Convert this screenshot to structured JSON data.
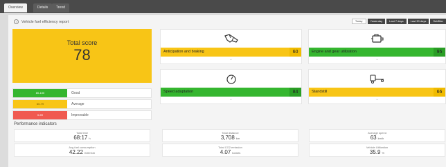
{
  "tabs": [
    {
      "label": "Overview"
    },
    {
      "label": "Details"
    },
    {
      "label": "Trend"
    }
  ],
  "report": {
    "title": "Vehicle fuel efficiency report"
  },
  "periods": [
    {
      "label": "Today"
    },
    {
      "label": "Yesterday"
    },
    {
      "label": "Last 7 days"
    },
    {
      "label": "Last 30 days"
    },
    {
      "label": "Set/filter"
    }
  ],
  "total_score": {
    "label": "Total score",
    "value": "78"
  },
  "legend": [
    {
      "range": "80-100",
      "label": "Good",
      "color": "#35b62f"
    },
    {
      "range": "60-79",
      "label": "Average",
      "color": "#f8c516"
    },
    {
      "range": "0-59",
      "label": "Improvable",
      "color": "#f05a50"
    }
  ],
  "categories": [
    {
      "label": "Anticipation and braking",
      "score": "60",
      "icon": "braking-hand-icon",
      "color": "yellow"
    },
    {
      "label": "Engine and gear utilization",
      "score": "95",
      "icon": "engine-icon",
      "color": "green"
    },
    {
      "label": "Speed adaptation",
      "score": "84",
      "icon": "speedometer-icon",
      "color": "green"
    },
    {
      "label": "Standstill",
      "score": "66",
      "icon": "standstill-truck-icon",
      "color": "yellow"
    }
  ],
  "performance": {
    "title": "Performance indicators",
    "stats": [
      {
        "label": "Total time",
        "value": "68:17",
        "unit": "h"
      },
      {
        "label": "Total distance",
        "value": "3,708",
        "unit": "km"
      },
      {
        "label": "Average speed",
        "value": "63",
        "unit": "km/h"
      },
      {
        "label": "Avg fuel consumption",
        "value": "42.22",
        "unit": "l/100 km"
      },
      {
        "label": "Total CO2 emission",
        "value": "4.07",
        "unit": "tonnes"
      },
      {
        "label": "Vehicle Utilization",
        "value": "35.9",
        "unit": "%"
      }
    ]
  }
}
